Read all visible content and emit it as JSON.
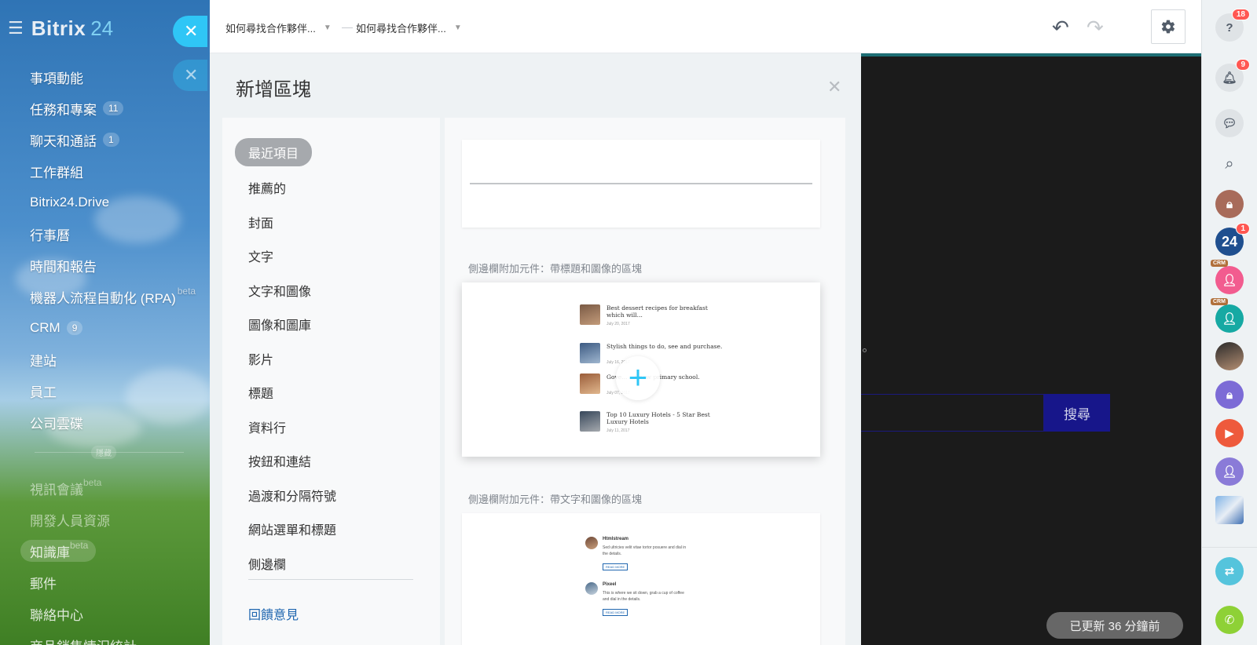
{
  "app": {
    "logo_name": "Bitrix",
    "logo_num": "24"
  },
  "sidebar": {
    "items": [
      {
        "label": "事項動能"
      },
      {
        "label": "任務和專案",
        "count": "11"
      },
      {
        "label": "聊天和通話",
        "count": "1"
      },
      {
        "label": "工作群組"
      },
      {
        "label": "Bitrix24.Drive"
      },
      {
        "label": "行事曆"
      },
      {
        "label": "時間和報告"
      },
      {
        "label": "機器人流程自動化 (RPA)",
        "beta": "beta"
      },
      {
        "label": "CRM",
        "count": "9"
      },
      {
        "label": "建站"
      },
      {
        "label": "員工"
      },
      {
        "label": "公司雲碟"
      }
    ],
    "divider_label": "隱藏",
    "hidden_items": [
      {
        "label": "視訊會議",
        "beta": "beta"
      },
      {
        "label": "開發人員資源"
      },
      {
        "label": "知識庫",
        "beta": "beta"
      },
      {
        "label": "郵件"
      },
      {
        "label": "聯絡中心"
      },
      {
        "label": "商品銷售情況統計"
      }
    ]
  },
  "topbar": {
    "crumb1": "如何尋找合作夥伴...",
    "crumb2": "如何尋找合作夥伴...",
    "separator": "—"
  },
  "dialog": {
    "title": "新增區塊",
    "categories": [
      "最近項目",
      "推薦的",
      "封面",
      "文字",
      "文字和圖像",
      "圖像和圖庫",
      "影片",
      "標題",
      "資料行",
      "按鈕和連結",
      "過渡和分隔符號",
      "網站選單和標題",
      "側邊欄"
    ],
    "feedback": "回饋意見",
    "block1_label": "側邊欄附加元件：帶標題和圖像的區塊",
    "block2_label": "側邊欄附加元件：帶文字和圖像的區塊",
    "posts": [
      {
        "title": "Best dessert recipes for breakfast which will...",
        "date": "July 20, 2017"
      },
      {
        "title": "Stylish things to do, see and purchase.",
        "date": "July 16, 2017"
      },
      {
        "title": "Gove... ...t new primary school.",
        "date": "July 07, 2017"
      },
      {
        "title": "Top 10 Luxury Hotels - 5 Star Best Luxury Hotels",
        "date": "July 11, 2017"
      }
    ],
    "minis": [
      {
        "title": "Htmlstream",
        "text": "Sed ultricies velit vitae tortor posuere and dial in the details.",
        "btn": "READ MORE"
      },
      {
        "title": "Pixeel",
        "text": "This is where we sit down, grab a cup of coffee and dial in the details.",
        "btn": "READ MORE"
      }
    ]
  },
  "preview": {
    "search_btn": "搜尋",
    "updated": "已更新 36 分鐘前"
  },
  "rightbar": {
    "help_count": "18",
    "notif_count": "9",
    "b24_count": "1",
    "b24_text": "24",
    "crm_tag": "CRM"
  },
  "colors": {
    "accent": "#2fc6f6",
    "badge": "#ff5752",
    "search": "#17168a"
  }
}
